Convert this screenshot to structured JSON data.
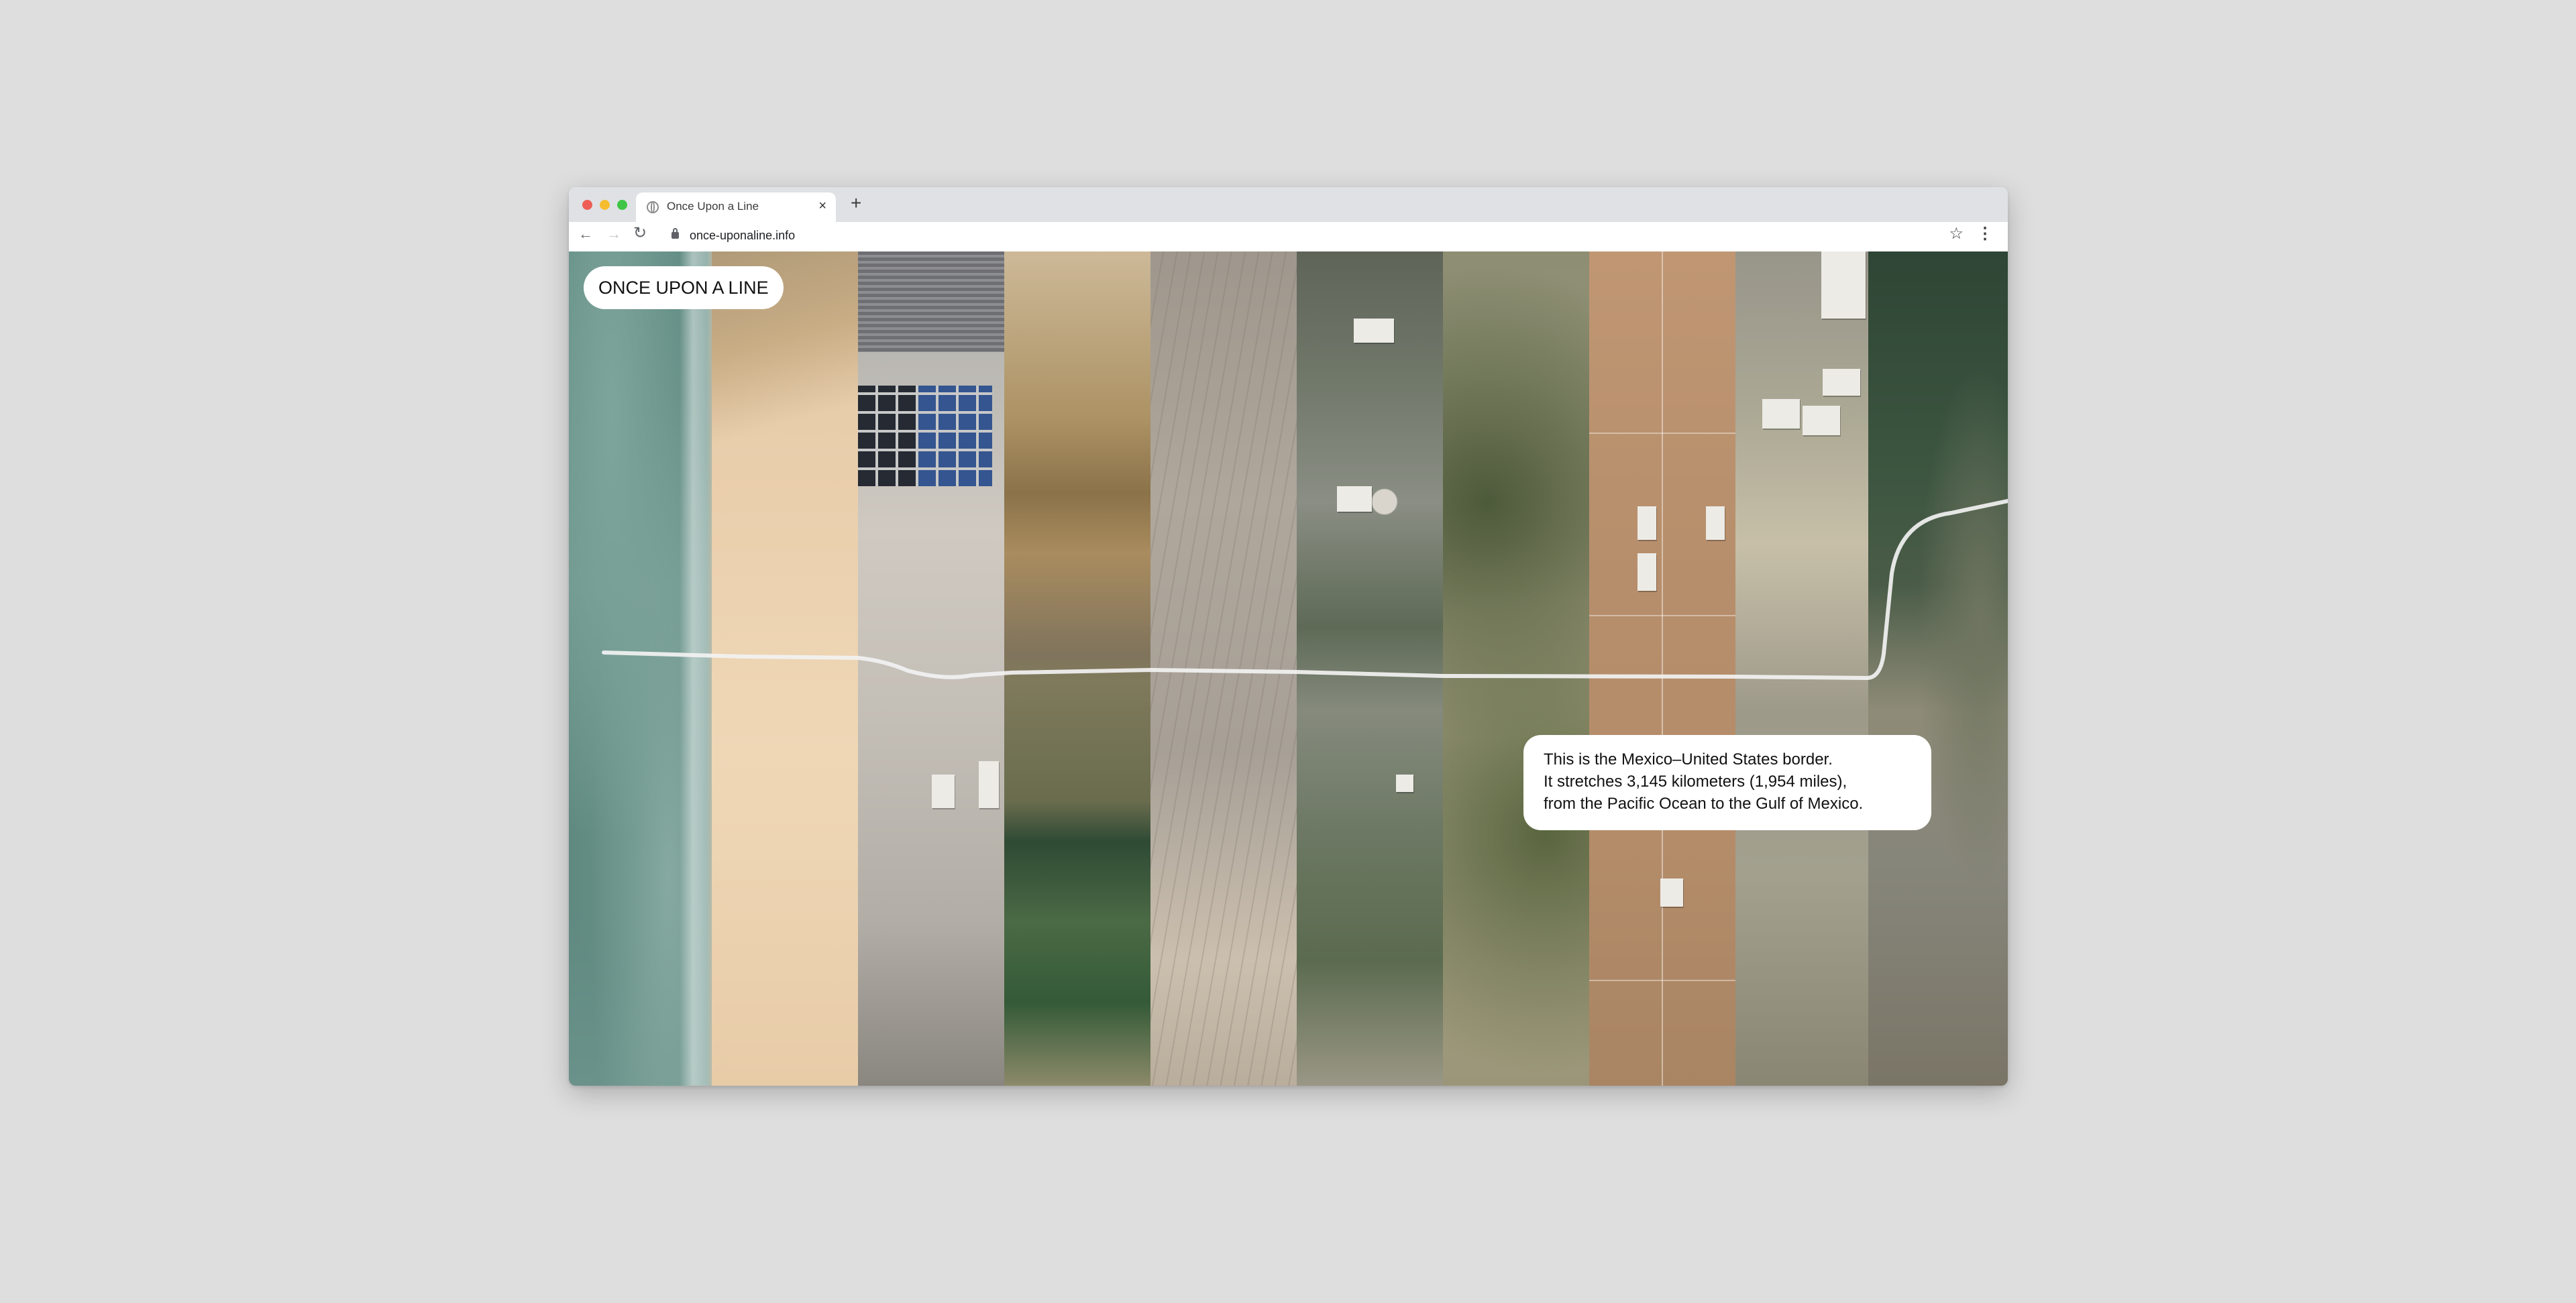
{
  "browser": {
    "tab_title": "Once Upon a Line",
    "new_tab_label": "+",
    "close_tab_label": "×",
    "url": "once-uponaline.info"
  },
  "icons": {
    "back": "arrow-left-icon",
    "forward": "arrow-right-icon",
    "reload": "reload-icon",
    "lock": "lock-icon",
    "bookmark": "star-icon",
    "menu": "kebab-menu-icon",
    "tab_favicon": "globe-icon"
  },
  "site": {
    "brand": "ONCE UPON A LINE",
    "info_lines": [
      "This is the Mexico–United States border.",
      "It stretches 3,145 kilometers (1,954 miles),",
      "from the Pacific Ocean to the Gulf of Mexico."
    ]
  },
  "colors": {
    "page_background": "#dedede",
    "tab_bar": "#dfe1e5",
    "border_line": "#f2f2f2"
  }
}
